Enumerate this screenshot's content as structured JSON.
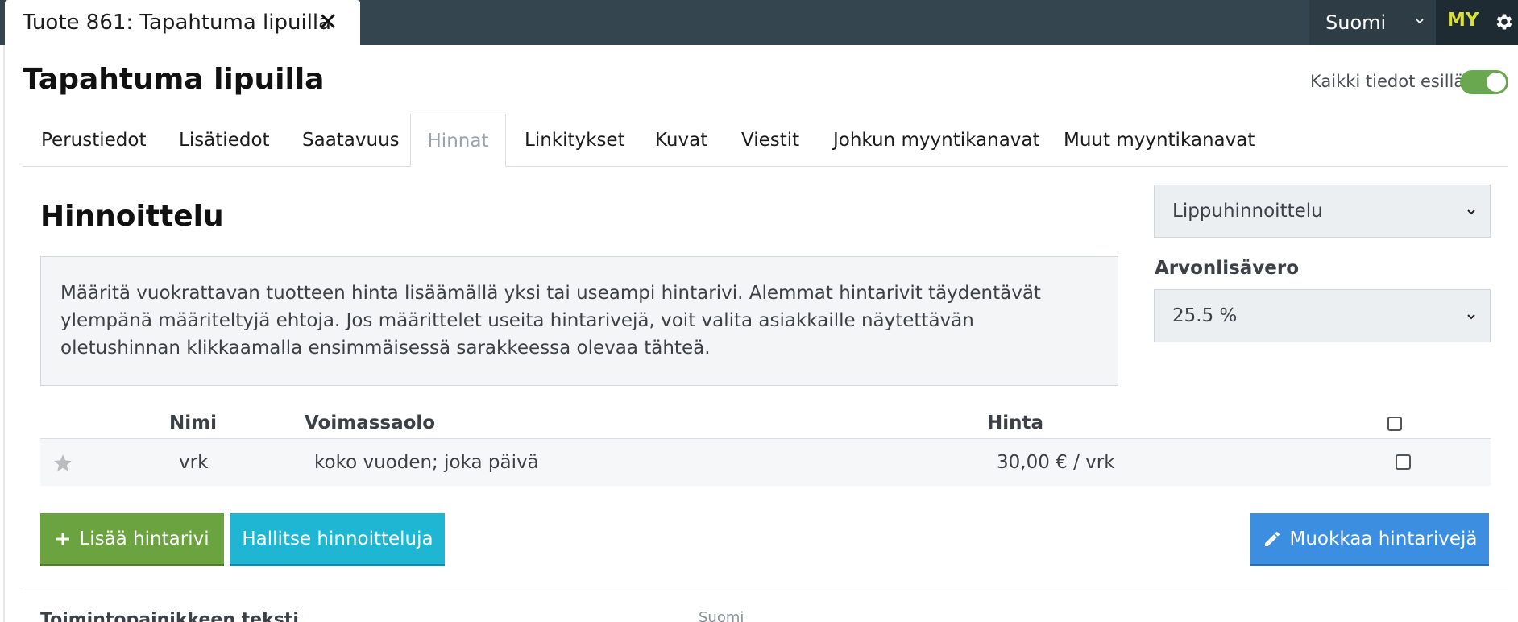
{
  "topbar": {
    "doc_tab_title": "Tuote 861: Tapahtuma lipuilla",
    "language": "Suomi",
    "user_initials": "MY"
  },
  "page": {
    "title": "Tapahtuma lipuilla",
    "toggle_label": "Kaikki tiedot esillä",
    "toggle_on": true
  },
  "tabs": [
    {
      "label": "Perustiedot"
    },
    {
      "label": "Lisätiedot"
    },
    {
      "label": "Saatavuus"
    },
    {
      "label": "Hinnat",
      "active": true
    },
    {
      "label": "Linkitykset"
    },
    {
      "label": "Kuvat"
    },
    {
      "label": "Viestit"
    },
    {
      "label": "Johkun myyntikanavat"
    },
    {
      "label": "Muut myyntikanavat"
    }
  ],
  "pricing": {
    "title": "Hinnoittelu",
    "info_text": "Määritä vuokrattavan tuotteen hinta lisäämällä yksi tai useampi hintarivi. Alemmat hintarivit täydentävät ylempänä määriteltyjä ehtoja. Jos määrittelet useita hintarivejä, voit valita asiakkaille näytettävän oletushinnan klikkaamalla ensimmäisessä sarakkeessa olevaa tähteä.",
    "pricing_type": "Lippuhinnoittelu",
    "vat_label": "Arvonlisävero",
    "vat_value": "25.5 %"
  },
  "table": {
    "headers": {
      "name": "Nimi",
      "validity": "Voimassaolo",
      "price": "Hinta"
    },
    "rows": [
      {
        "name": "vrk",
        "validity": "koko vuoden; joka päivä",
        "price": "30,00 € / vrk"
      }
    ]
  },
  "buttons": {
    "add": "Lisää hintarivi",
    "manage": "Hallitse hinnoitteluja",
    "edit": "Muokkaa hintarivejä"
  },
  "footer": {
    "label": "Toimintopainikkeen teksti",
    "language": "Suomi"
  },
  "colors": {
    "topbar": "#34454f",
    "toggle_on": "#6aa84f",
    "btn_add": "#6aa33f",
    "btn_manage": "#1fb6d4",
    "btn_edit": "#3b8ee0"
  }
}
